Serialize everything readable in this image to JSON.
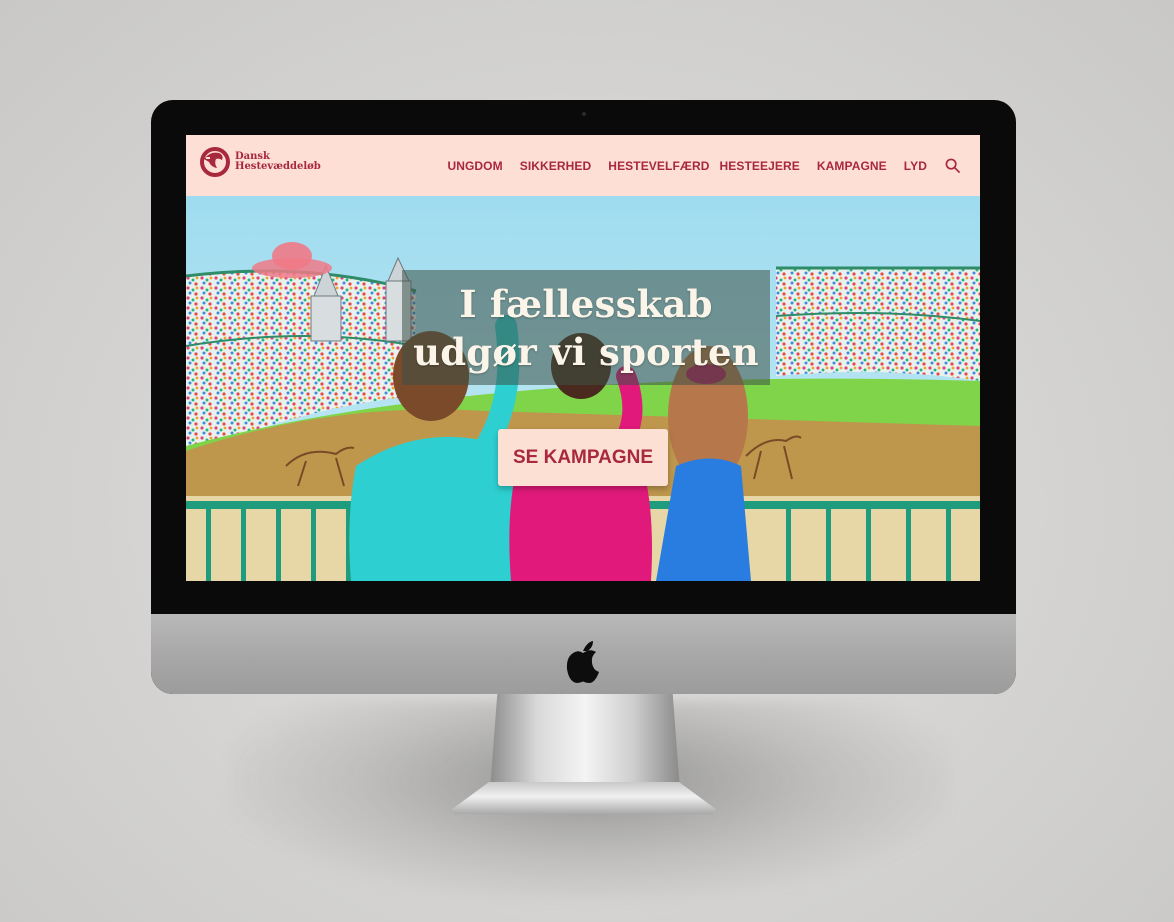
{
  "site": {
    "logo_line1": "Dansk",
    "logo_line2": "Hestevæddeløb"
  },
  "nav": {
    "items": [
      {
        "label": "UNGDOM"
      },
      {
        "label": "SIKKERHED"
      },
      {
        "label": "HESTEVELFÆRD"
      },
      {
        "label": "HESTEEJERE"
      },
      {
        "label": "KAMPAGNE"
      },
      {
        "label": "LYD"
      }
    ],
    "search_icon": "search-icon"
  },
  "hero": {
    "headline_line1": "I fællesskab",
    "headline_line2": "udgør vi sporten",
    "cta_label": "SE KAMPAGNE"
  },
  "colors": {
    "brand": "#a8283c",
    "nav_bg": "#fddfd5",
    "sky": "#9fdcf0",
    "grass": "#7fd44a"
  }
}
